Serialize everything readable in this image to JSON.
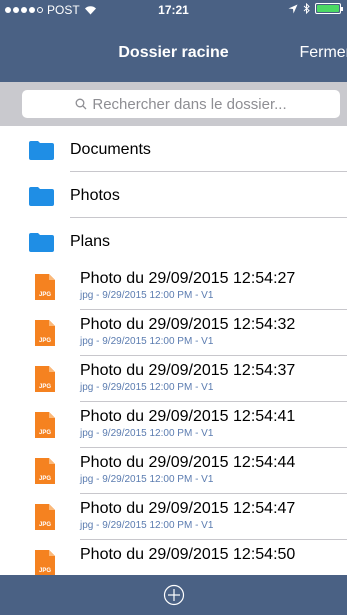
{
  "status_bar": {
    "carrier": "POST",
    "time": "17:21"
  },
  "nav": {
    "title": "Dossier racine",
    "right_button": "Fermer"
  },
  "search": {
    "placeholder": "Rechercher dans le dossier..."
  },
  "folders": [
    {
      "name": "Documents"
    },
    {
      "name": "Photos"
    },
    {
      "name": "Plans"
    }
  ],
  "files": [
    {
      "name": "Photo du 29/09/2015 12:54:27",
      "meta": "jpg - 9/29/2015 12:00 PM - V1",
      "icon_label": "JPG"
    },
    {
      "name": "Photo du 29/09/2015 12:54:32",
      "meta": "jpg - 9/29/2015 12:00 PM - V1",
      "icon_label": "JPG"
    },
    {
      "name": "Photo du 29/09/2015 12:54:37",
      "meta": "jpg - 9/29/2015 12:00 PM - V1",
      "icon_label": "JPG"
    },
    {
      "name": "Photo du 29/09/2015 12:54:41",
      "meta": "jpg - 9/29/2015 12:00 PM - V1",
      "icon_label": "JPG"
    },
    {
      "name": "Photo du 29/09/2015 12:54:44",
      "meta": "jpg - 9/29/2015 12:00 PM - V1",
      "icon_label": "JPG"
    },
    {
      "name": "Photo du 29/09/2015 12:54:47",
      "meta": "jpg - 9/29/2015 12:00 PM - V1",
      "icon_label": "JPG"
    },
    {
      "name": "Photo du 29/09/2015 12:54:50",
      "meta": "",
      "icon_label": "JPG"
    }
  ],
  "colors": {
    "nav_background": "#4a6184",
    "folder_icon": "#1f8ee5",
    "jpg_icon": "#f58220",
    "meta_text": "#5b7cb0",
    "battery": "#4cd964"
  },
  "icons": {
    "search": "search-icon",
    "folder": "folder-icon",
    "file": "jpg-file-icon",
    "add": "add-circle-icon"
  }
}
